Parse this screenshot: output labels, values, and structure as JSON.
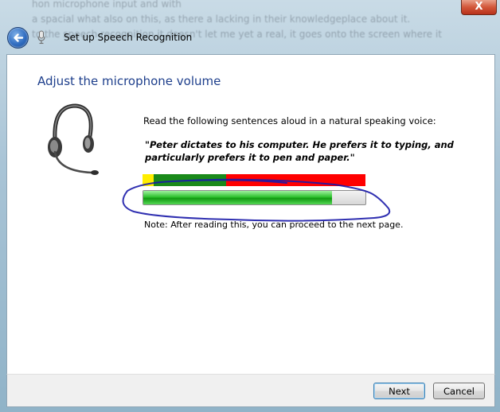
{
  "window": {
    "title": "Set up Speech Recognition",
    "close_label": "X",
    "background_text": [
      "hon microphone input and with",
      "a spacial what also on this, as there a lacking in their knowledgeplace about it.",
      "to the speech recognition it doesn't let me yet a real, it goes onto the screen where it"
    ]
  },
  "page": {
    "heading": "Adjust the microphone volume",
    "instruction": "Read the following sentences aloud in a natural speaking voice:",
    "quote": "\"Peter dictates to his computer. He prefers it to typing, and particularly prefers it to pen and paper.\"",
    "note": "Note: After reading this, you can proceed to the next page.",
    "volume_level": 0.85
  },
  "footer": {
    "next_label": "Next",
    "cancel_label": "Cancel"
  },
  "colors": {
    "heading": "#1e3f8c",
    "meter_low": "#ffee00",
    "meter_ok": "#1a8a1a",
    "meter_high": "#ff0000",
    "progress_fill": "#2fc22f",
    "annotation": "#1a1aa8"
  },
  "icons": [
    "close-icon",
    "back-arrow-icon",
    "microphone-icon",
    "headset-icon"
  ]
}
